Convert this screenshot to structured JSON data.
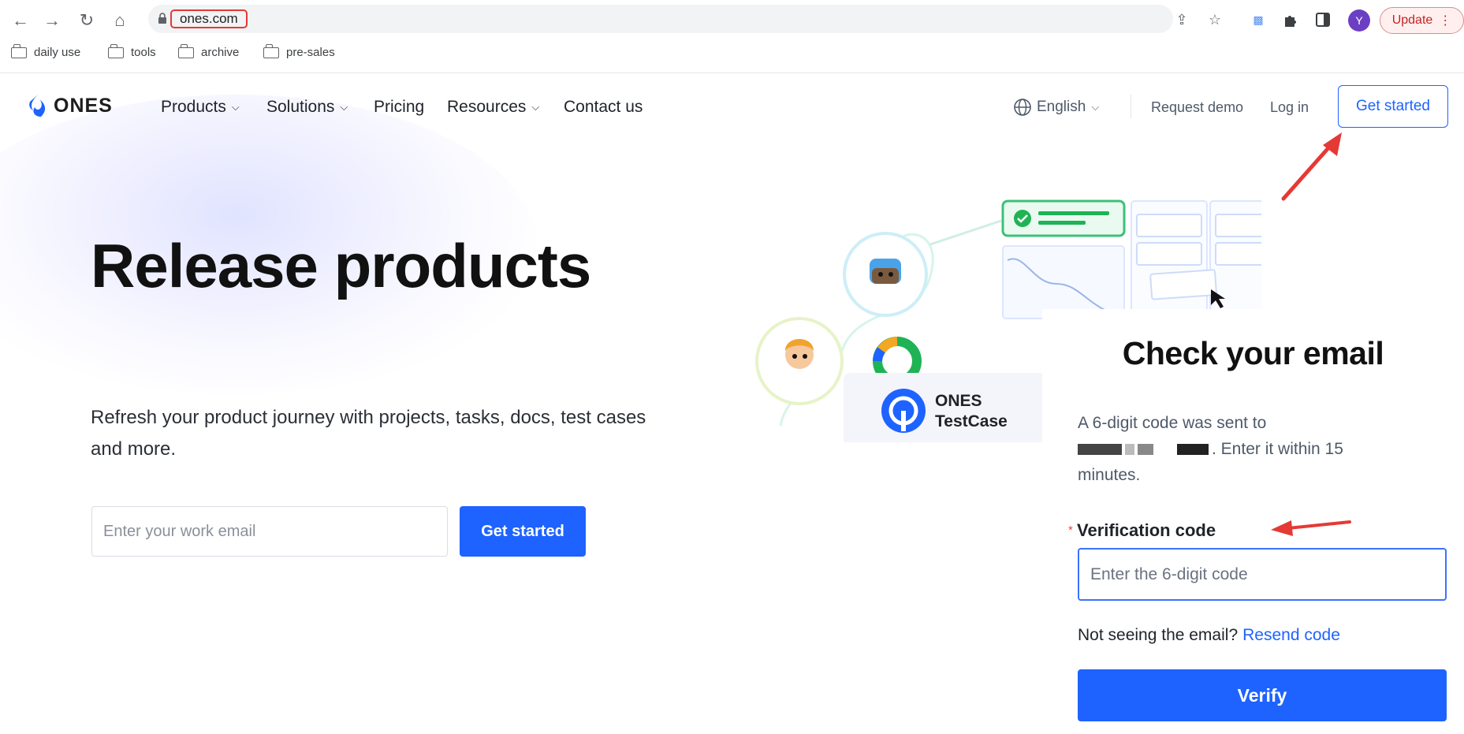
{
  "browser": {
    "url": "ones.com",
    "update_label": "Update",
    "avatar_letter": "Y",
    "bookmarks": [
      "daily use",
      "tools",
      "archive",
      "pre-sales"
    ]
  },
  "site_nav": {
    "logo": "ONES",
    "items": [
      "Products",
      "Solutions",
      "Pricing",
      "Resources",
      "Contact us"
    ],
    "language": "English",
    "request_demo": "Request demo",
    "login": "Log in",
    "get_started": "Get started"
  },
  "hero": {
    "title": "Release products",
    "subtitle": "Refresh your product journey with projects, tasks, docs, test cases and more.",
    "email_placeholder": "Enter your work email",
    "cta": "Get started"
  },
  "illustration": {
    "product_name_line1": "ONES",
    "product_name_line2": "TestCase"
  },
  "verification": {
    "title": "Check your email",
    "desc_prefix": "A 6-digit code was sent to",
    "desc_suffix": ". Enter it within 15 minutes.",
    "field_label": "Verification code",
    "field_placeholder": "Enter the 6-digit code",
    "resend_prompt": "Not seeing the email?",
    "resend_link": "Resend code",
    "verify_button": "Verify"
  },
  "colors": {
    "brand_blue": "#1e63ff",
    "annotation_red": "#e53935"
  }
}
